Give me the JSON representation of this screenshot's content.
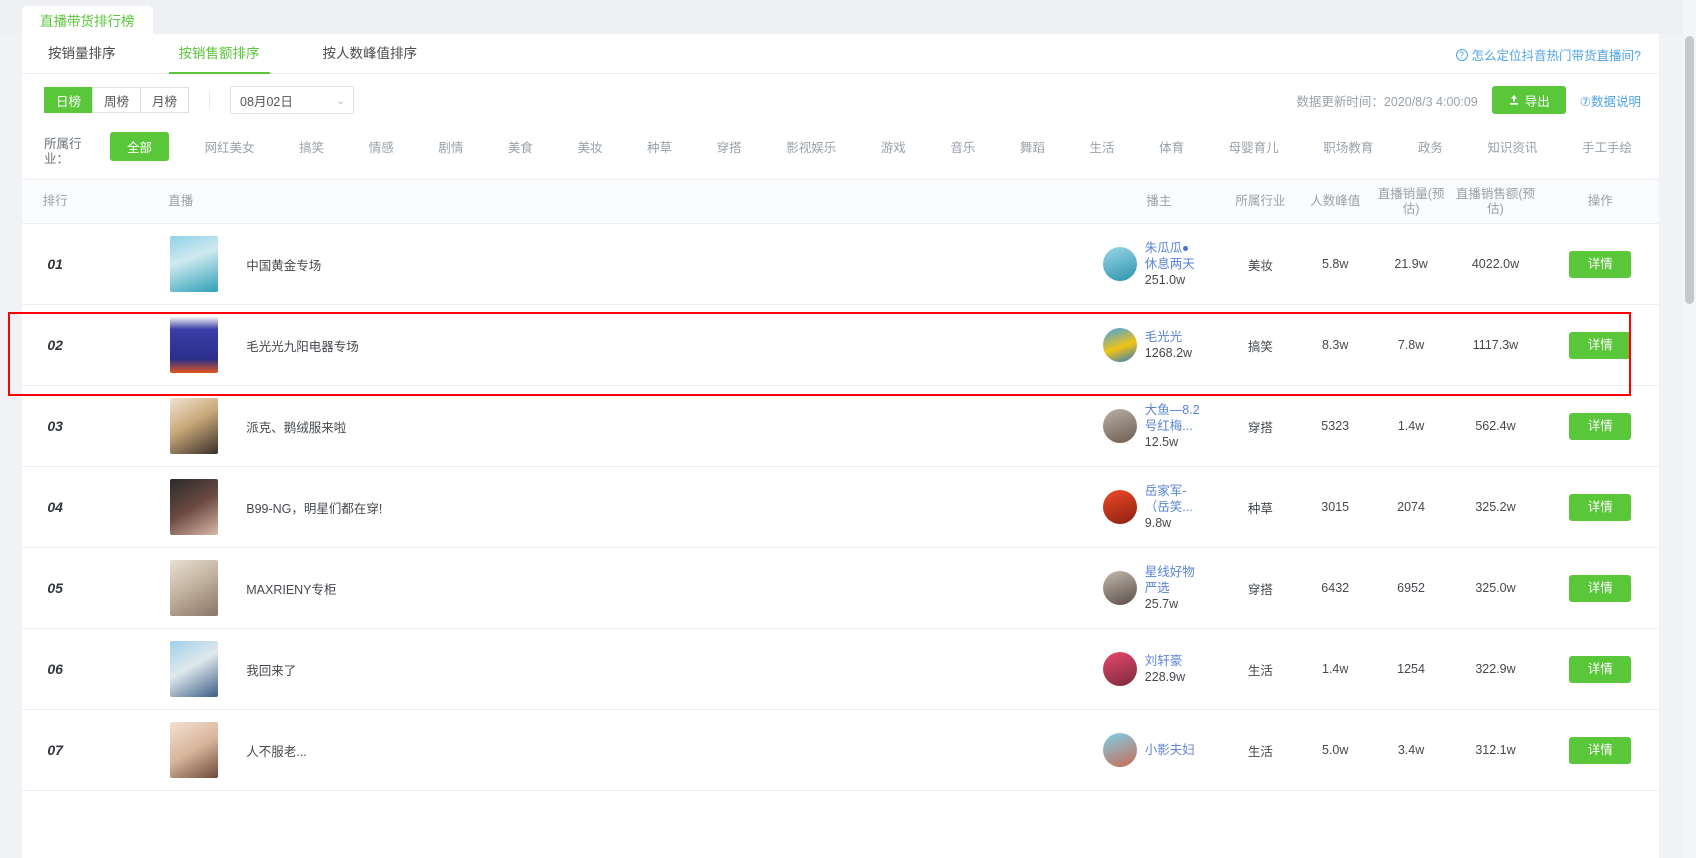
{
  "browser_tab": {
    "title": "直播带货排行榜"
  },
  "sort_tabs": [
    {
      "label": "按销量排序",
      "active": false
    },
    {
      "label": "按销售额排序",
      "active": true
    },
    {
      "label": "按人数峰值排序",
      "active": false
    }
  ],
  "help_link": {
    "label": "怎么定位抖音热门带货直播间?",
    "icon": "question-circle-icon"
  },
  "period": {
    "options": [
      {
        "label": "日榜",
        "active": true
      },
      {
        "label": "周榜",
        "active": false
      },
      {
        "label": "月榜",
        "active": false
      }
    ],
    "date_value": "08月02日",
    "chevron": "⌄"
  },
  "toolbar": {
    "update_time_label": "数据更新时间：2020/8/3 4:00:09",
    "export_label": "导出",
    "export_icon": "upload-icon",
    "data_desc_label": "数据说明"
  },
  "industry_filter": {
    "label": "所属行业：",
    "items": [
      {
        "label": "全部",
        "active": true
      },
      {
        "label": "网红美女",
        "active": false
      },
      {
        "label": "搞笑",
        "active": false
      },
      {
        "label": "情感",
        "active": false
      },
      {
        "label": "剧情",
        "active": false
      },
      {
        "label": "美食",
        "active": false
      },
      {
        "label": "美妆",
        "active": false
      },
      {
        "label": "种草",
        "active": false
      },
      {
        "label": "穿搭",
        "active": false
      },
      {
        "label": "影视娱乐",
        "active": false
      },
      {
        "label": "游戏",
        "active": false
      },
      {
        "label": "音乐",
        "active": false
      },
      {
        "label": "舞蹈",
        "active": false
      },
      {
        "label": "生活",
        "active": false
      },
      {
        "label": "体育",
        "active": false
      },
      {
        "label": "母婴育儿",
        "active": false
      },
      {
        "label": "职场教育",
        "active": false
      },
      {
        "label": "政务",
        "active": false
      },
      {
        "label": "知识资讯",
        "active": false
      },
      {
        "label": "手工手绘",
        "active": false
      }
    ]
  },
  "table": {
    "headers": {
      "rank": "排行",
      "live": "直播",
      "host": "播主",
      "industry": "所属行业",
      "peak": "人数峰值",
      "sales": "直播销量(预估)",
      "amount": "直播销售额(预估)",
      "action": "操作"
    },
    "detail_label": "详情",
    "rows": [
      {
        "rank": "01",
        "live_title": "中国黄金专场",
        "host_name": "朱瓜瓜",
        "host_name2": "休息两天",
        "host_badge": true,
        "fans": "251.0w",
        "industry": "美妆",
        "peak": "5.8w",
        "sales": "21.9w",
        "amount": "4022.0w",
        "highlighted": false
      },
      {
        "rank": "02",
        "live_title": "毛光光九阳电器专场",
        "host_name": "毛光光",
        "host_name2": "",
        "host_badge": false,
        "fans": "1268.2w",
        "industry": "搞笑",
        "peak": "8.3w",
        "sales": "7.8w",
        "amount": "1117.3w",
        "highlighted": true
      },
      {
        "rank": "03",
        "live_title": "派克、鹅绒服来啦",
        "host_name": "大鱼—8.2",
        "host_name2": "号红梅...",
        "host_badge": false,
        "fans": "12.5w",
        "industry": "穿搭",
        "peak": "5323",
        "sales": "1.4w",
        "amount": "562.4w",
        "highlighted": false
      },
      {
        "rank": "04",
        "live_title": "B99-NG，明星们都在穿!",
        "host_name": "岳家军-",
        "host_name2": "（岳笑...",
        "host_badge": false,
        "fans": "9.8w",
        "industry": "种草",
        "peak": "3015",
        "sales": "2074",
        "amount": "325.2w",
        "highlighted": false
      },
      {
        "rank": "05",
        "live_title": "MAXRIENY专柜",
        "host_name": "星线好物",
        "host_name2": "严选",
        "host_badge": false,
        "fans": "25.7w",
        "industry": "穿搭",
        "peak": "6432",
        "sales": "6952",
        "amount": "325.0w",
        "highlighted": false
      },
      {
        "rank": "06",
        "live_title": "我回来了",
        "host_name": "刘轩豪",
        "host_name2": "",
        "host_badge": false,
        "fans": "228.9w",
        "industry": "生活",
        "peak": "1.4w",
        "sales": "1254",
        "amount": "322.9w",
        "highlighted": false
      },
      {
        "rank": "07",
        "live_title": "人不服老...",
        "host_name": "小影夫妇",
        "host_name2": "",
        "host_badge": false,
        "fans": "",
        "industry": "生活",
        "peak": "5.0w",
        "sales": "3.4w",
        "amount": "312.1w",
        "highlighted": false
      }
    ]
  },
  "colors": {
    "brand_green": "#5ac63a",
    "link_blue": "#4da3e8",
    "host_blue": "#5b84d6",
    "highlight_red": "#ff0000"
  }
}
